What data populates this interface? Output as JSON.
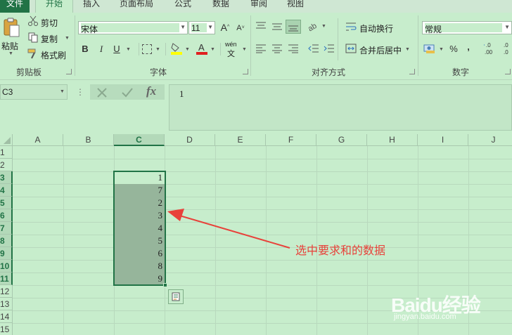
{
  "tabs": [
    "文件",
    "开始",
    "插入",
    "页面布局",
    "公式",
    "数据",
    "审阅",
    "视图"
  ],
  "clipboard": {
    "paste": "粘贴",
    "cut": "剪切",
    "copy": "复制",
    "format_painter": "格式刷",
    "group_label": "剪贴板"
  },
  "font": {
    "name": "宋体",
    "size": "11",
    "bold": "B",
    "italic": "I",
    "underline": "U",
    "phonetic": "wén",
    "group_label": "字体"
  },
  "alignment": {
    "wrap": "自动换行",
    "merge": "合并后居中",
    "group_label": "对齐方式"
  },
  "number": {
    "format": "常规",
    "percent": "%",
    "comma": ",",
    "group_label": "数字"
  },
  "formula_bar": {
    "name_box": "C3",
    "fx": "fx",
    "value": "1"
  },
  "columns": [
    "A",
    "B",
    "C",
    "D",
    "E",
    "F",
    "G",
    "H",
    "I",
    "J"
  ],
  "rows": [
    "1",
    "2",
    "3",
    "4",
    "5",
    "6",
    "7",
    "8",
    "9",
    "10",
    "11",
    "12",
    "13",
    "14",
    "15"
  ],
  "selected_range": {
    "column": "C",
    "first_row": 3,
    "last_row": 11
  },
  "cells_c": [
    "1",
    "7",
    "2",
    "3",
    "4",
    "5",
    "6",
    "8",
    "9"
  ],
  "annotation": "选中要求和的数据",
  "watermark": {
    "brand": "Baidu经验",
    "url": "jingyan.baidu.com"
  },
  "colors": {
    "accent": "#217346",
    "background": "#c7edcc",
    "selection_fill": "#96b59b",
    "annotation": "#e8413a"
  }
}
